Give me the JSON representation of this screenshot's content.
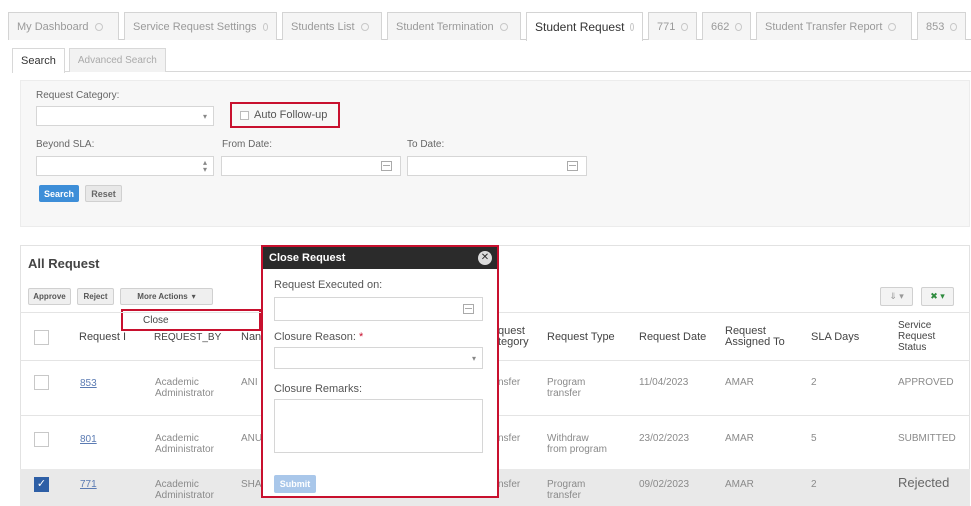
{
  "top_tabs": [
    {
      "label": "My Dashboard"
    },
    {
      "label": "Service Request Settings"
    },
    {
      "label": "Students List"
    },
    {
      "label": "Student Termination"
    },
    {
      "label": "Student Request"
    },
    {
      "label": "771"
    },
    {
      "label": "662"
    },
    {
      "label": "Student Transfer Report"
    },
    {
      "label": "853"
    }
  ],
  "sub_tabs": [
    {
      "label": "Search"
    },
    {
      "label": "Advanced Search"
    }
  ],
  "search": {
    "request_category_label": "Request Category:",
    "auto_followup_label": "Auto Follow-up",
    "beyond_sla_label": "Beyond SLA:",
    "from_date_label": "From Date:",
    "to_date_label": "To Date:",
    "search_button": "Search",
    "reset_button": "Reset"
  },
  "requests": {
    "title": "All Request",
    "approve_button": "Approve",
    "reject_button": "Reject",
    "more_actions_button": "More Actions",
    "more_actions_menu": [
      "Close"
    ],
    "columns": [
      "Request I",
      "REQUEST_BY",
      "Nan",
      "quest\ntegory",
      "Request Type",
      "Request Date",
      "Request\nAssigned To",
      "SLA Days",
      "Service\nRequest\nStatus"
    ],
    "rows": [
      {
        "id": "853",
        "request_by": "Academic\nAdministrator",
        "name": "ANI",
        "category": "nsfer",
        "type": "Program\ntransfer",
        "date": "11/04/2023",
        "assigned_to": "AMAR",
        "sla_days": "2",
        "status": "APPROVED",
        "checked": false
      },
      {
        "id": "801",
        "request_by": "Academic\nAdministrator",
        "name": "ANU",
        "category": "nsfer",
        "type": "Withdraw\nfrom program",
        "date": "23/02/2023",
        "assigned_to": "AMAR",
        "sla_days": "5",
        "status": "SUBMITTED",
        "checked": false
      },
      {
        "id": "771",
        "request_by": "Academic\nAdministrator",
        "name": "SHA",
        "category": "nsfer",
        "type": "Program\ntransfer",
        "date": "09/02/2023",
        "assigned_to": "AMAR",
        "sla_days": "2",
        "status": "Rejected",
        "checked": true
      }
    ]
  },
  "modal": {
    "title": "Close Request",
    "executed_on_label": "Request Executed on:",
    "closure_reason_label": "Closure Reason:",
    "required_mark": "*",
    "closure_remarks_label": "Closure Remarks:",
    "submit_button": "Submit"
  },
  "colors": {
    "accent": "#3d8ed8",
    "highlight_border": "#c8102e",
    "modal_header": "#2b2b2b",
    "checked": "#2e5fa6"
  }
}
